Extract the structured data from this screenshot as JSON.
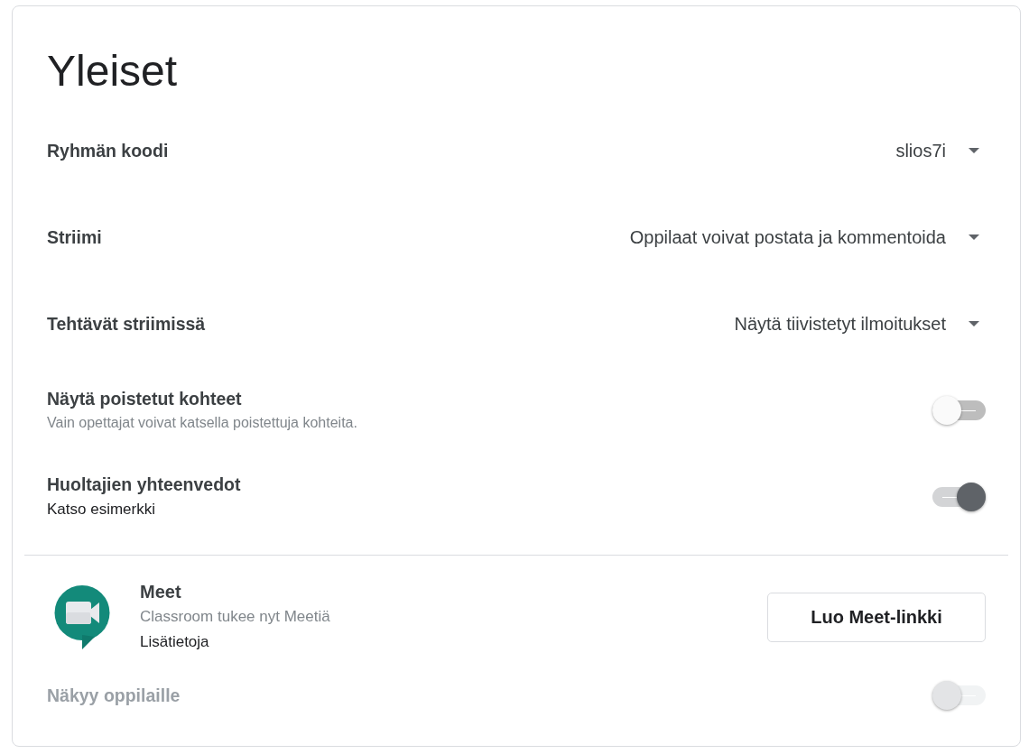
{
  "title": "Yleiset",
  "settings": [
    {
      "kind": "dropdown",
      "label": "Ryhmän koodi",
      "value": "slios7i"
    },
    {
      "kind": "dropdown",
      "label": "Striimi",
      "value": "Oppilaat voivat postata ja kommentoida"
    },
    {
      "kind": "dropdown",
      "label": "Tehtävät striimissä",
      "value": "Näytä tiivistetyt ilmoitukset"
    },
    {
      "kind": "toggle",
      "label": "Näytä poistetut kohteet",
      "description": "Vain opettajat voivat katsella poistettuja kohteita.",
      "on": false
    },
    {
      "kind": "toggle",
      "label": "Huoltajien yhteenvedot",
      "link": "Katso esimerkki",
      "on": true
    }
  ],
  "meet": {
    "title": "Meet",
    "description": "Classroom tukee nyt Meetiä",
    "link": "Lisätietoja",
    "button": "Luo Meet-linkki",
    "visibility": {
      "label": "Näkyy oppilaille",
      "on": false,
      "disabled": true
    }
  }
}
